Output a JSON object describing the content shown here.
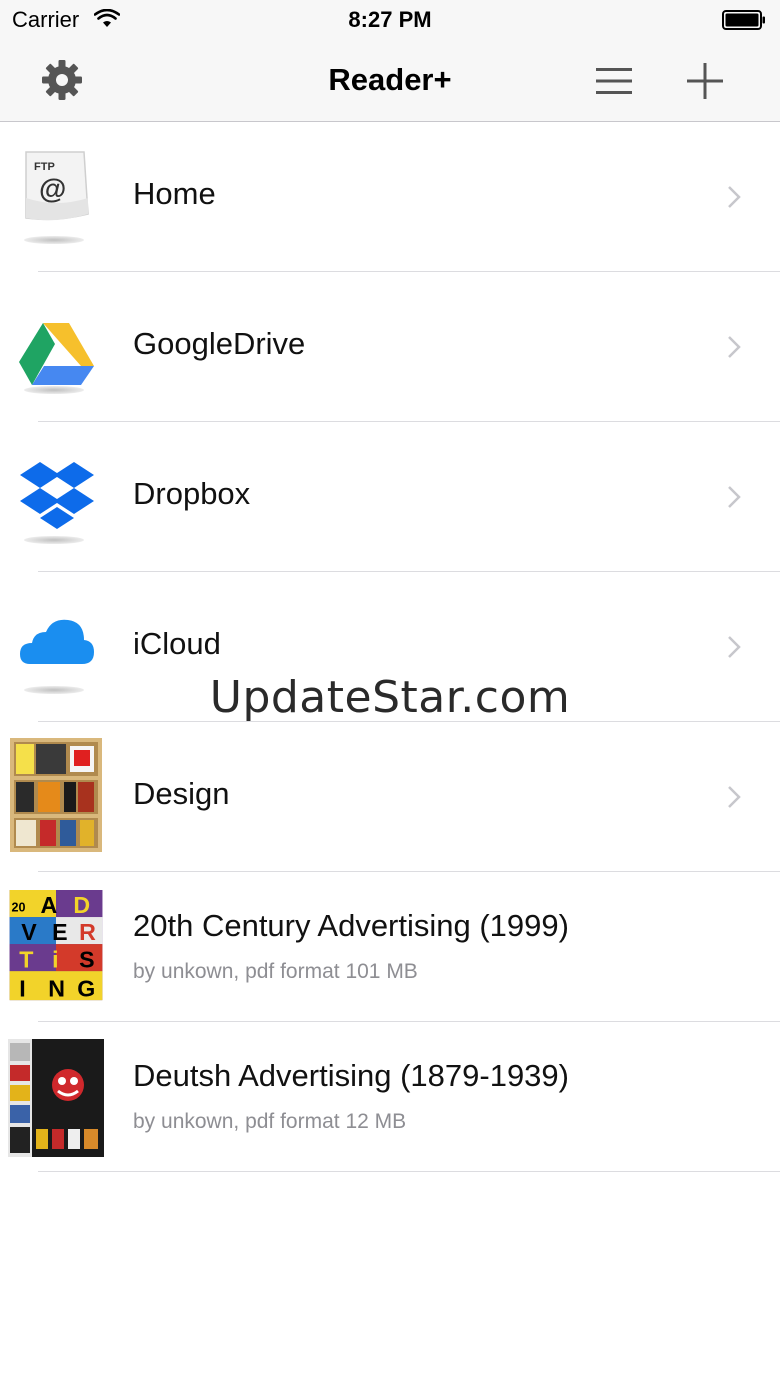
{
  "status": {
    "carrier": "Carrier",
    "time": "8:27 PM"
  },
  "nav": {
    "title": "Reader+",
    "left_icon": "gear-icon",
    "right_icons": [
      "list-icon",
      "plus-icon"
    ]
  },
  "items": [
    {
      "label": "Home",
      "icon": "ftp-icon",
      "chevron": true
    },
    {
      "label": "GoogleDrive",
      "icon": "google-drive-icon",
      "chevron": true
    },
    {
      "label": "Dropbox",
      "icon": "dropbox-icon",
      "chevron": true
    },
    {
      "label": "iCloud",
      "icon": "icloud-icon",
      "chevron": true
    },
    {
      "label": "Design",
      "icon": "bookshelf-icon",
      "chevron": true
    },
    {
      "label": "20th Century Advertising (1999)",
      "subtitle": "by unkown, pdf format 101 MB",
      "icon": "book-cover-icon",
      "cover_text": [
        "20",
        "A",
        "D",
        "V",
        "E",
        "R",
        "T",
        "i",
        "S",
        "I",
        "N",
        "G"
      ]
    },
    {
      "label": "Deutsh Advertising (1879-1939)",
      "subtitle": "by unkown, pdf format 12 MB",
      "icon": "book-cover-icon"
    }
  ],
  "watermark": "UpdateStar.com",
  "colors": {
    "chevron": "#c7c7cc",
    "separator": "#dcdce0",
    "subtitle": "#8e8e93",
    "bar": "#f7f7f7"
  }
}
